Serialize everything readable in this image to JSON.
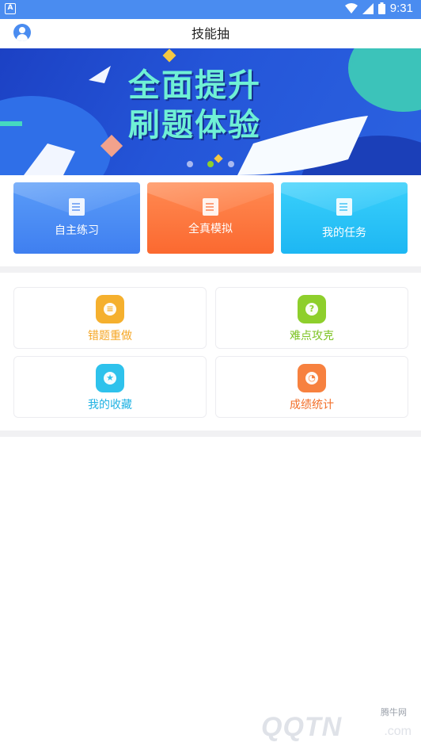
{
  "status_bar": {
    "time": "9:31",
    "notification_icon_label": "A",
    "icons": [
      "wifi-icon",
      "signal-icon",
      "battery-icon"
    ]
  },
  "header": {
    "title": "技能抽",
    "avatar_icon": "user-avatar-icon"
  },
  "banner": {
    "title_line1": "全面提升",
    "title_line2": "刷题体验",
    "indicator_count": 3,
    "active_indicator": 1,
    "colors": {
      "background": "#2455d8",
      "text": "#6ff0d5",
      "accent": "#f5c842",
      "diamond": "#f2a28c"
    }
  },
  "actions": [
    {
      "label": "自主练习",
      "icon": "edit-note-icon",
      "color_top": "#5a9cf8",
      "color_bottom": "#3f7ff0"
    },
    {
      "label": "全真模拟",
      "icon": "scroll-icon",
      "color_top": "#ff8a52",
      "color_bottom": "#fb6930"
    },
    {
      "label": "我的任务",
      "icon": "task-check-icon",
      "color_top": "#3ad0fb",
      "color_bottom": "#1db7f3"
    }
  ],
  "grid": [
    {
      "label": "错题重做",
      "icon": "redo-card-icon",
      "color": "#f5b02e",
      "glyph": "≡"
    },
    {
      "label": "难点攻克",
      "icon": "question-icon",
      "color": "#8ecf2c",
      "glyph": "?"
    },
    {
      "label": "我的收藏",
      "icon": "star-icon",
      "color": "#2ec2ec",
      "glyph": "★"
    },
    {
      "label": "成绩统计",
      "icon": "pie-chart-icon",
      "color": "#f7813f",
      "glyph": "◔"
    }
  ],
  "watermark": {
    "brand": "QQTN",
    "suffix": ".com",
    "small": "腾牛网"
  }
}
